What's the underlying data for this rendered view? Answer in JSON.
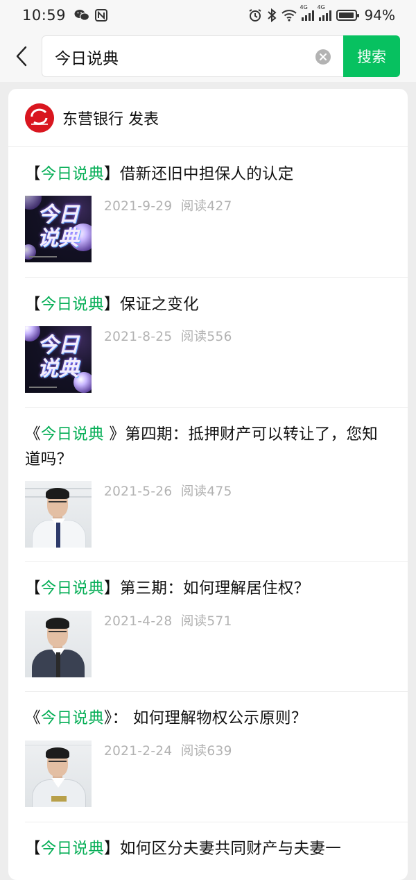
{
  "status_bar": {
    "time": "10:59",
    "left_icons": [
      "wechat-icon",
      "nfc-icon"
    ],
    "right_icons": [
      "alarm-icon",
      "bluetooth-icon",
      "wifi-icon",
      "signal-4g-icon",
      "signal-4g-icon",
      "battery-icon"
    ],
    "network_label_1": "4G",
    "network_label_2": "4G",
    "battery_level": 94,
    "battery_text": "94%"
  },
  "search": {
    "query": "今日说典",
    "button_label": "搜索"
  },
  "publisher": {
    "name": "东营银行 发表",
    "logo_text": "东营银行"
  },
  "articles": [
    {
      "title_prefix_open": "【",
      "title_highlight": "今日说典",
      "title_prefix_close": "】",
      "title_rest": "借新还旧中担保人的认定",
      "date": "2021-9-29",
      "reads": "阅读427",
      "thumb_type": "cover",
      "thumb_text_1": "今日",
      "thumb_text_2": "说典"
    },
    {
      "title_prefix_open": "【",
      "title_highlight": "今日说典",
      "title_prefix_close": "】",
      "title_rest": "保证之变化",
      "date": "2021-8-25",
      "reads": "阅读556",
      "thumb_type": "cover",
      "thumb_text_1": "今日",
      "thumb_text_2": "说典"
    },
    {
      "title_prefix_open": "《",
      "title_highlight": "今日说典",
      "title_prefix_close": " 》",
      "title_rest": "第四期：抵押财产可以转让了，您知道吗？",
      "date": "2021-5-26",
      "reads": "阅读475",
      "thumb_type": "person"
    },
    {
      "title_prefix_open": "【",
      "title_highlight": "今日说典",
      "title_prefix_close": "】",
      "title_rest": "第三期：如何理解居住权？",
      "date": "2021-4-28",
      "reads": "阅读571",
      "thumb_type": "person"
    },
    {
      "title_prefix_open": "《",
      "title_highlight": "今日说典",
      "title_prefix_close": "》",
      "title_rest": "： 如何理解物权公示原则？",
      "date": "2021-2-24",
      "reads": "阅读639",
      "thumb_type": "person"
    },
    {
      "title_prefix_open": "【",
      "title_highlight": "今日说典",
      "title_prefix_close": "】",
      "title_rest": "如何区分夫妻共同财产与夫妻一",
      "thumb_type": "none"
    }
  ],
  "colors": {
    "accent": "#07c160",
    "highlight": "#06ae56",
    "meta": "#b2b2b2",
    "background": "#ededed"
  }
}
